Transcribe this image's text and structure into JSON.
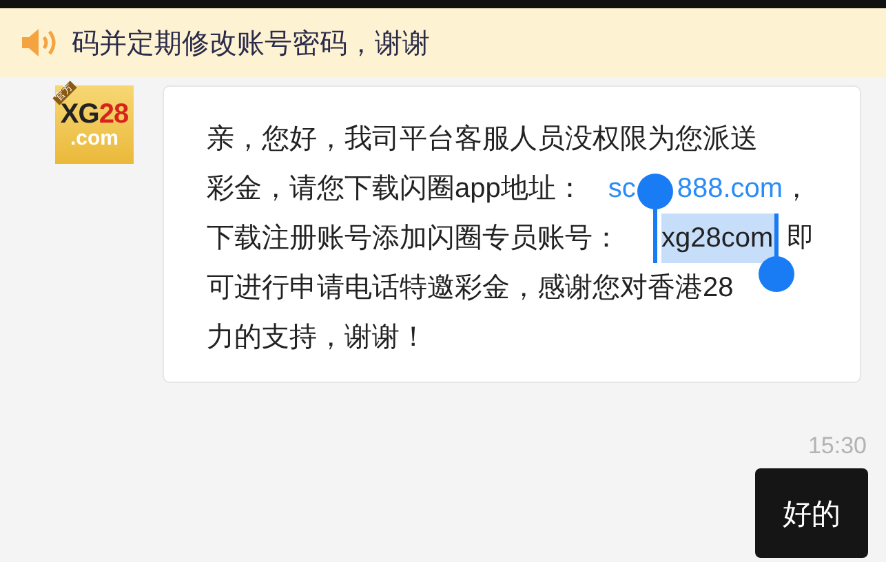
{
  "notice": {
    "text": "码并定期修改账号密码，谢谢"
  },
  "messages": [
    {
      "kind": "received",
      "avatar": {
        "brand": "XG28",
        "suffix": ".com",
        "tag": "官方"
      },
      "lines": [
        [
          {
            "kind": "text",
            "text": "亲，您好，我司平台客服人员没权限为您派送"
          }
        ],
        [
          {
            "kind": "text",
            "text": "彩金，请您下载闪圈app地址："
          },
          {
            "kind": "link",
            "text": "sc"
          },
          {
            "kind": "handle"
          },
          {
            "kind": "link",
            "text": "888.com"
          },
          {
            "kind": "text",
            "text": "，"
          }
        ],
        [
          {
            "kind": "text",
            "text": "下载注册账号添加闪圈专员账号："
          },
          {
            "kind": "selected",
            "text": "xg28com"
          },
          {
            "kind": "text",
            "text": "即"
          }
        ],
        [
          {
            "kind": "text",
            "text": "可进行申请电话特邀彩金，感谢您对香港28"
          }
        ],
        [
          {
            "kind": "text",
            "text": "力的支持，谢谢！"
          }
        ]
      ]
    },
    {
      "kind": "time",
      "text": "15:30"
    },
    {
      "kind": "sent",
      "text": "好的"
    }
  ]
}
